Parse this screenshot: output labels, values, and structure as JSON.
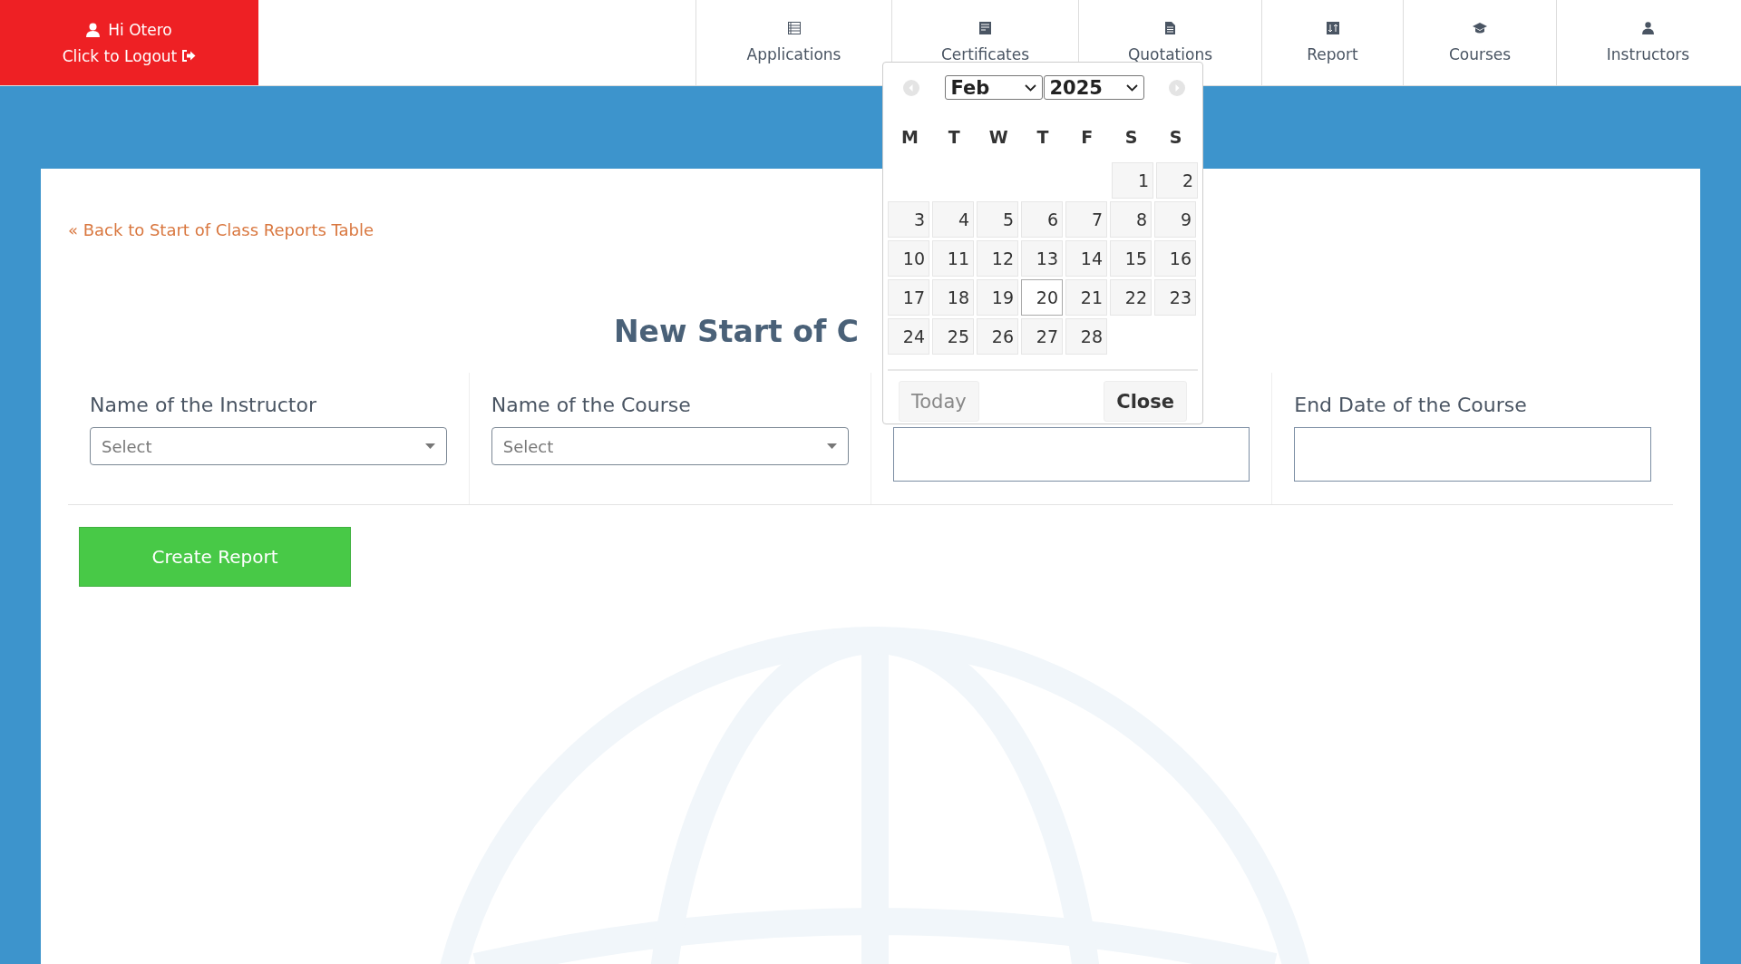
{
  "user_box": {
    "greeting": "Hi Otero",
    "logout": "Click to Logout"
  },
  "nav": [
    {
      "label": "Applications",
      "kind": "list"
    },
    {
      "label": "Certificates",
      "kind": "certificate"
    },
    {
      "label": "Quotations",
      "kind": "document"
    },
    {
      "label": "Report",
      "kind": "report"
    },
    {
      "label": "Courses",
      "kind": "cap"
    },
    {
      "label": "Instructors",
      "kind": "person"
    }
  ],
  "back_link": "« Back to Start of Class Reports Table",
  "title": "New Start of C",
  "fields": [
    {
      "label": "Name of the Instructor",
      "kind": "select",
      "placeholder": "Select"
    },
    {
      "label": "Name of the Course",
      "kind": "select",
      "placeholder": "Select"
    },
    {
      "kind": "date"
    },
    {
      "label": "End Date of the Course",
      "kind": "date"
    }
  ],
  "create_button": "Create Report",
  "datepicker": {
    "month": "Feb",
    "year": "2025",
    "weekdays": [
      "M",
      "T",
      "W",
      "T",
      "F",
      "S",
      "S"
    ],
    "weeks": [
      {
        "days": [
          {
            "label": "1",
            "selected": false
          },
          {
            "label": "2",
            "selected": false
          }
        ]
      },
      {
        "days": [
          {
            "label": "3",
            "selected": false
          },
          {
            "label": "4",
            "selected": false
          },
          {
            "label": "5",
            "selected": false
          },
          {
            "label": "6",
            "selected": false
          },
          {
            "label": "7",
            "selected": false
          },
          {
            "label": "8",
            "selected": false
          },
          {
            "label": "9",
            "selected": false
          }
        ]
      },
      {
        "days": [
          {
            "label": "10",
            "selected": false
          },
          {
            "label": "11",
            "selected": false
          },
          {
            "label": "12",
            "selected": false
          },
          {
            "label": "13",
            "selected": false
          },
          {
            "label": "14",
            "selected": false
          },
          {
            "label": "15",
            "selected": false
          },
          {
            "label": "16",
            "selected": false
          }
        ]
      },
      {
        "days": [
          {
            "label": "17",
            "selected": false
          },
          {
            "label": "18",
            "selected": false
          },
          {
            "label": "19",
            "selected": false
          },
          {
            "label": "20",
            "selected": true
          },
          {
            "label": "21",
            "selected": false
          },
          {
            "label": "22",
            "selected": false
          },
          {
            "label": "23",
            "selected": false
          }
        ]
      },
      {
        "days": [
          {
            "label": "24",
            "selected": false
          },
          {
            "label": "25",
            "selected": false
          },
          {
            "label": "26",
            "selected": false
          },
          {
            "label": "27",
            "selected": false
          },
          {
            "label": "28",
            "selected": false
          }
        ]
      }
    ],
    "today_button": "Today",
    "close_button": "Close"
  }
}
